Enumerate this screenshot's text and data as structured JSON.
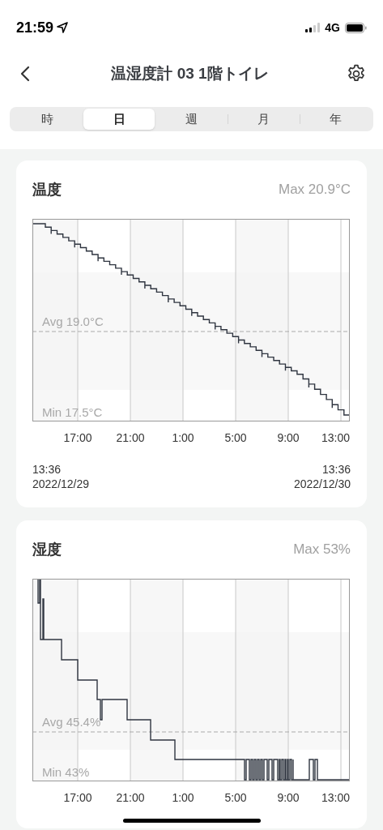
{
  "status_bar": {
    "time": "21:59",
    "network": "4G"
  },
  "nav": {
    "title": "温湿度計 03 1階トイレ"
  },
  "tabs": [
    {
      "label": "時",
      "selected": false
    },
    {
      "label": "日",
      "selected": true
    },
    {
      "label": "週",
      "selected": false
    },
    {
      "label": "月",
      "selected": false
    },
    {
      "label": "年",
      "selected": false
    }
  ],
  "cards": [
    {
      "kind": "temperature",
      "title": "温度",
      "max": "Max 20.9°C",
      "avg": "Avg 19.0°C",
      "min": "Min 17.5°C",
      "x_labels": [
        "17:00",
        "21:00",
        "1:00",
        "5:00",
        "9:00",
        "13:00"
      ],
      "start": {
        "time": "13:36",
        "date": "2022/12/29"
      },
      "end": {
        "time": "13:36",
        "date": "2022/12/30"
      }
    },
    {
      "kind": "humidity",
      "title": "湿度",
      "max": "Max 53%",
      "avg": "Avg 45.4%",
      "min": "Min 43%",
      "x_labels": [
        "17:00",
        "21:00",
        "1:00",
        "5:00",
        "9:00",
        "13:00"
      ]
    }
  ]
}
